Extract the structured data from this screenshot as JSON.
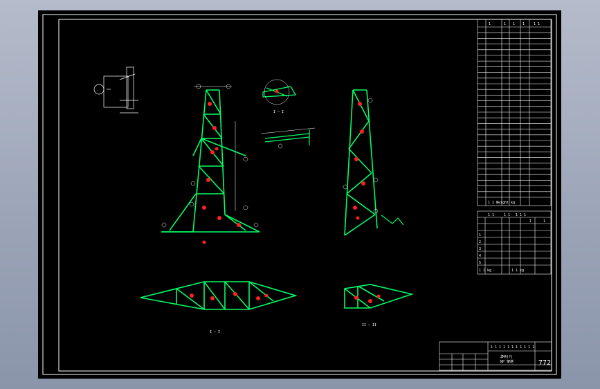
{
  "sheet": {
    "drawing_number": "772",
    "title_block_header": "1 1 1 1 1 1 1 1 1 1 1",
    "title_block_name": "ZM4(?)",
    "title_block_sub": "NP 架塔"
  },
  "parts_table": {
    "header": [
      "1",
      "1",
      "1",
      "1",
      "1 1"
    ],
    "rows": 30,
    "footer": "1 1   Weight kg"
  },
  "summary_table": {
    "header": [
      "1 1",
      "1 1",
      "1 1 1",
      "1",
      "1"
    ],
    "total_label": "1 1 kg",
    "total_value": "1 1 kg"
  },
  "views": {
    "section_top": "I — I",
    "section_right": "II — II",
    "section_plan": "I — I"
  },
  "colors": {
    "frame": "#ffffff",
    "member": "#00ff66",
    "weld": "#ff2020",
    "dim": "#ffffff"
  }
}
